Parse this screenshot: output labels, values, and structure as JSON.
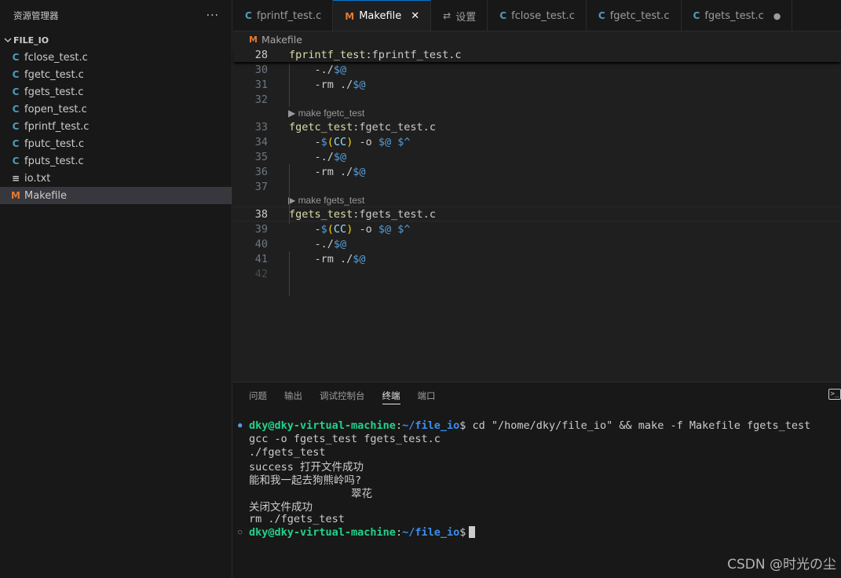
{
  "sidebar": {
    "title": "资源管理器",
    "more": "···",
    "section": "FILE_IO",
    "files": [
      {
        "icon": "C",
        "kind": "c",
        "name": "fclose_test.c"
      },
      {
        "icon": "C",
        "kind": "c",
        "name": "fgetc_test.c"
      },
      {
        "icon": "C",
        "kind": "c",
        "name": "fgets_test.c"
      },
      {
        "icon": "C",
        "kind": "c",
        "name": "fopen_test.c"
      },
      {
        "icon": "C",
        "kind": "c",
        "name": "fprintf_test.c"
      },
      {
        "icon": "C",
        "kind": "c",
        "name": "fputc_test.c"
      },
      {
        "icon": "C",
        "kind": "c",
        "name": "fputs_test.c"
      },
      {
        "icon": "≡",
        "kind": "t",
        "name": "io.txt"
      },
      {
        "icon": "M",
        "kind": "m",
        "name": "Makefile"
      }
    ]
  },
  "tabs": [
    {
      "icon": "C",
      "kind": "c",
      "label": "fprintf_test.c"
    },
    {
      "icon": "M",
      "kind": "m",
      "label": "Makefile",
      "close": "✕"
    },
    {
      "icon": "⇄",
      "kind": "g",
      "label": "设置"
    },
    {
      "icon": "C",
      "kind": "c",
      "label": "fclose_test.c"
    },
    {
      "icon": "C",
      "kind": "c",
      "label": "fgetc_test.c"
    },
    {
      "icon": "C",
      "kind": "c",
      "label": "fgets_test.c",
      "dot": "●"
    }
  ],
  "editor": {
    "breadcrumb_icon": "M",
    "breadcrumb": "Makefile",
    "sticky": {
      "num": "28",
      "target": "fprintf_test",
      "rest": ":fprintf_test.c"
    },
    "lines_a": [
      {
        "num": "30",
        "text": "    -./$@"
      },
      {
        "num": "31",
        "text": "    -rm ./$@"
      },
      {
        "num": "32",
        "text": ""
      }
    ],
    "codelens_1": "▶ make fgetc_test",
    "lines_b": [
      {
        "num": "33",
        "target": "fgetc_test",
        "rest": ":fgetc_test.c"
      },
      {
        "num": "34",
        "cmd": "cc"
      },
      {
        "num": "35",
        "text": "    -./$@"
      },
      {
        "num": "36",
        "text": "    -rm ./$@"
      },
      {
        "num": "37",
        "text": ""
      }
    ],
    "codelens_2": "▶ make fgets_test",
    "lines_c": [
      {
        "num": "38",
        "target": "fgets_test",
        "rest": ":fgets_test.c"
      },
      {
        "num": "39",
        "cmd": "cc"
      },
      {
        "num": "40",
        "text": "    -./$@"
      },
      {
        "num": "41",
        "text": "    -rm ./$@"
      },
      {
        "num": "42",
        "text": ""
      }
    ]
  },
  "panel": {
    "tabs": [
      "问题",
      "输出",
      "调试控制台",
      "终端",
      "端口"
    ],
    "active_tab": "终端",
    "term_icon": ">_",
    "terminal": {
      "user": "dky@dky-virtual-machine",
      "path": "~/file_io",
      "command": "$ cd \"/home/dky/file_io\" && make -f Makefile fgets_test",
      "output": [
        "gcc -o fgets_test fgets_test.c",
        "./fgets_test",
        "success 打开文件成功",
        "能和我一起去狗熊岭吗?",
        "                翠花",
        "关闭文件成功",
        "rm ./fgets_test"
      ],
      "prompt_end": "$"
    }
  },
  "watermark": "CSDN @时光の尘"
}
